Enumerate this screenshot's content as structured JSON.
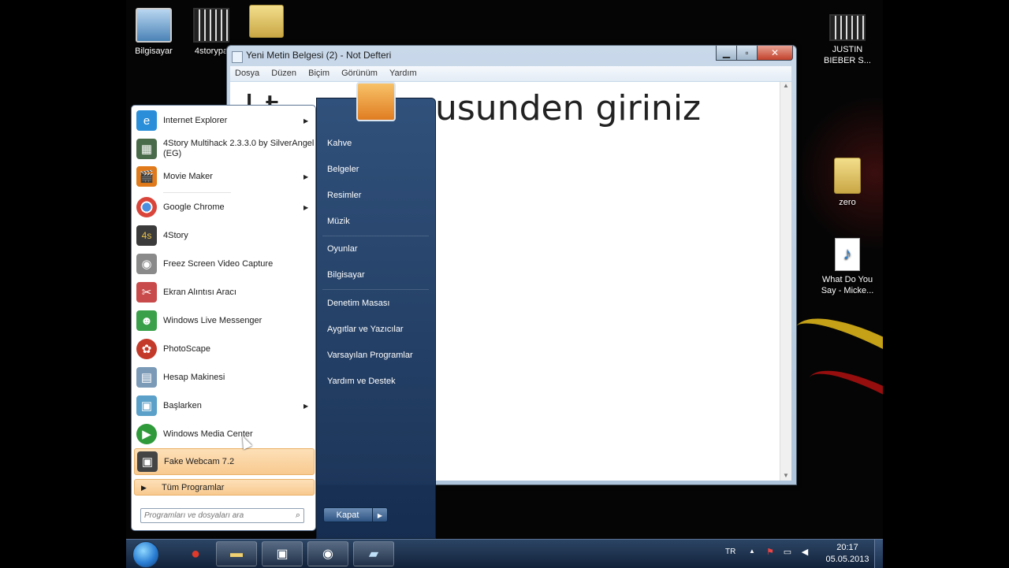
{
  "desktop_icons": [
    {
      "label": "Bilgisayar"
    },
    {
      "label": "4storypa"
    },
    {
      "label": ""
    },
    {
      "label": "JUSTIN BIEBER S..."
    },
    {
      "label": "zero"
    },
    {
      "label": "What Do You Say - Micke..."
    }
  ],
  "notepad": {
    "title": "Yeni Metin Belgesi (2) - Not Defteri",
    "menu": [
      "Dosya",
      "Düzen",
      "Biçim",
      "Görünüm",
      "Yardım"
    ],
    "content_visible": "usunden giriniz",
    "content_fragment": "l         t"
  },
  "start_menu": {
    "programs": [
      {
        "label": "Internet Explorer",
        "icon": "ie-icon",
        "color": "#2a8fd8",
        "arrow": "▶"
      },
      {
        "label": "4Story Multihack 2.3.3.0 by SilverAngel (EG)",
        "icon": "app-window-icon",
        "color": "#4a6b4a",
        "arrow": ""
      },
      {
        "label": "Movie Maker",
        "icon": "movie-maker-icon",
        "color": "#e07a1a",
        "arrow": "▶"
      },
      {
        "label": "Google Chrome",
        "icon": "chrome-icon",
        "color": "#d9453b",
        "arrow": "▶"
      },
      {
        "label": "4Story",
        "icon": "4story-icon",
        "color": "#3b3b3b",
        "arrow": ""
      },
      {
        "label": "Freez Screen Video Capture",
        "icon": "camera-icon",
        "color": "#8a8a8a",
        "arrow": ""
      },
      {
        "label": "Ekran Alıntısı Aracı",
        "icon": "scissors-icon",
        "color": "#c94a4a",
        "arrow": ""
      },
      {
        "label": "Windows Live Messenger",
        "icon": "messenger-icon",
        "color": "#3aa04a",
        "arrow": ""
      },
      {
        "label": "PhotoScape",
        "icon": "photoscape-icon",
        "color": "#c43a2a",
        "arrow": ""
      },
      {
        "label": "Hesap Makinesi",
        "icon": "calculator-icon",
        "color": "#7a9ab8",
        "arrow": ""
      },
      {
        "label": "Başlarken",
        "icon": "getting-started-icon",
        "color": "#5aa0c8",
        "arrow": "▶"
      },
      {
        "label": "Windows Media Center",
        "icon": "media-center-icon",
        "color": "#2f9a3a",
        "arrow": ""
      },
      {
        "label": "Fake Webcam 7.2",
        "icon": "webcam-icon",
        "color": "#444444",
        "arrow": ""
      }
    ],
    "all_programs": "Tüm Programlar",
    "search_placeholder": "Programları ve dosyaları ara",
    "right_items": [
      "Kahve",
      "Belgeler",
      "Resimler",
      "Müzik",
      "Oyunlar",
      "Bilgisayar",
      "Denetim Masası",
      "Aygıtlar ve Yazıcılar",
      "Varsayılan Programlar",
      "Yardım ve Destek"
    ],
    "shutdown": "Kapat"
  },
  "taskbar": {
    "language": "TR",
    "time": "20:17",
    "date": "05.05.2013"
  }
}
